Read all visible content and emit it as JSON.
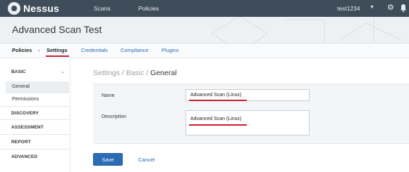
{
  "app": {
    "brand": "Nessus",
    "nav": [
      "Scans",
      "Policies"
    ],
    "user": "test1234",
    "caret": "▼",
    "settings_icon": "gear-icon",
    "notification_icon": "bell-icon"
  },
  "header": {
    "title": "Advanced Scan Test"
  },
  "tabs": {
    "crumb": "Policies",
    "separator": "›",
    "items": [
      "Settings",
      "Credentials",
      "Compliance",
      "Plugins"
    ],
    "active": "Settings",
    "underline_color": "#c8213a"
  },
  "sidebar": {
    "basic": "BASIC",
    "basic_caret": "⌄",
    "basic_items": [
      "General",
      "Permissions"
    ],
    "sections": [
      "DISCOVERY",
      "ASSESSMENT",
      "REPORT",
      "ADVANCED"
    ]
  },
  "main": {
    "breadcrumb": {
      "a": "Settings",
      "b": "Basic",
      "sep": " / ",
      "current": "General"
    },
    "name_label": "Name",
    "name_value": "Advanced Scan (Linux)",
    "description_label": "Description",
    "description_value": "Advanced Scan (Linux)",
    "save": "Save",
    "cancel": "Cancel"
  },
  "colors": {
    "topbar": "#3f4c5a",
    "primary": "#2b6cb7",
    "link": "#2a6ab2",
    "annotation_red": "#c81e2c"
  }
}
